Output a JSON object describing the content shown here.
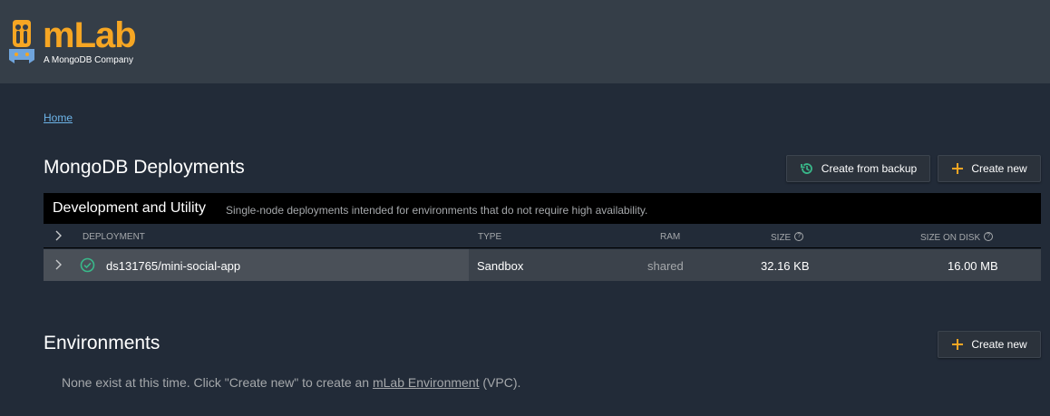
{
  "brand": {
    "name": "mLab",
    "tagline": "A MongoDB Company",
    "color": "#f6a623"
  },
  "breadcrumb": {
    "home": "Home"
  },
  "deployments": {
    "title": "MongoDB Deployments",
    "create_from_backup": "Create from backup",
    "create_new": "Create new",
    "group": {
      "title": "Development and Utility",
      "description": "Single-node deployments intended for environments that do not require high availability."
    },
    "columns": {
      "deployment": "DEPLOYMENT",
      "type": "TYPE",
      "ram": "RAM",
      "size": "SIZE",
      "size_on_disk": "SIZE ON DISK"
    },
    "rows": [
      {
        "name": "ds131765/mini-social-app",
        "type": "Sandbox",
        "ram": "shared",
        "size": "32.16 KB",
        "size_on_disk": "16.00 MB",
        "status": "ok"
      }
    ]
  },
  "environments": {
    "title": "Environments",
    "create_new": "Create new",
    "empty_pre": "None exist at this time. Click \"Create new\" to create an ",
    "empty_link": "mLab Environment",
    "empty_post": " (VPC)."
  },
  "icons": {
    "history": "history-icon",
    "plus": "plus-icon",
    "check": "check-circle-icon",
    "chevron": "chevron-right-icon",
    "help": "help-icon"
  },
  "colors": {
    "accent_yellow": "#f6a623",
    "status_green": "#39b98a",
    "link_blue": "#6db4e8"
  }
}
